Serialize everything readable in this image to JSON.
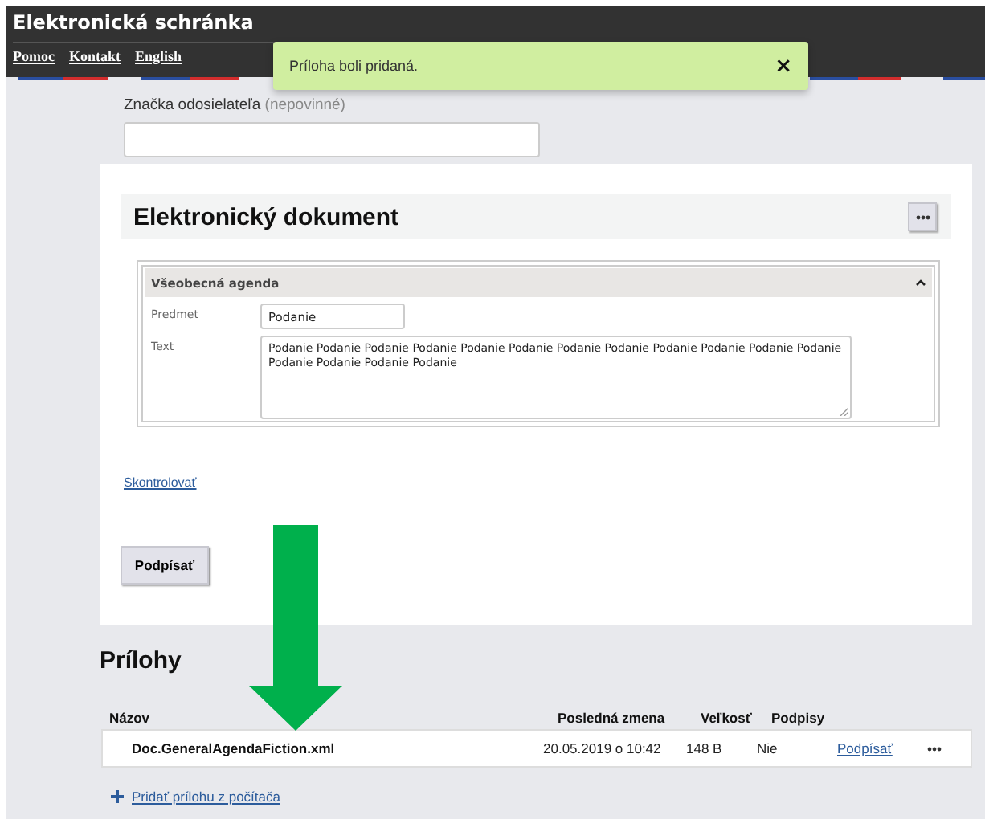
{
  "header": {
    "title": "Elektronická schránka",
    "links": [
      "Pomoc",
      "Kontakt",
      "English"
    ]
  },
  "toast": {
    "message": "Príloha boli pridaná.",
    "close": "×"
  },
  "sender_field": {
    "label": "Značka odosielateľa",
    "hint": "(nepovinné)"
  },
  "document": {
    "title": "Elektronický dokument",
    "section": {
      "title": "Všeobecná agenda",
      "expanded": true,
      "fields": [
        {
          "label": "Predmet",
          "kind": "input",
          "value": "Podanie"
        },
        {
          "label": "Text",
          "kind": "textarea",
          "value": "Podanie Podanie Podanie Podanie Podanie Podanie Podanie Podanie Podanie Podanie Podanie Podanie Podanie Podanie Podanie Podanie"
        }
      ]
    },
    "check_link": "Skontrolovať",
    "sign_button": "Podpísať"
  },
  "attachments": {
    "title": "Prílohy",
    "columns": [
      "Názov",
      "Posledná zmena",
      "Veľkosť",
      "Podpisy"
    ],
    "rows": [
      {
        "name": "Doc.GeneralAgendaFiction.xml",
        "modified": "20.05.2019 o 10:42",
        "size": "148 B",
        "signatures": "Nie",
        "action": "Podpísať"
      }
    ],
    "add_link": "Pridať prílohu z počítača"
  }
}
